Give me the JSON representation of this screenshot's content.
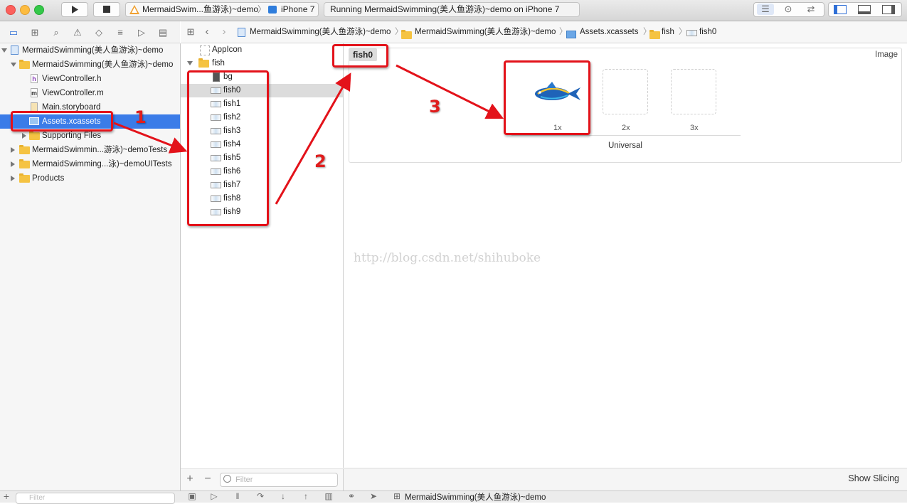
{
  "toolbar": {
    "scheme_target": "MermaidSwim...鱼游泳)~demo",
    "device": "iPhone 7",
    "activity": "Running MermaidSwimming(美人鱼游泳)~demo on iPhone 7"
  },
  "navigator": {
    "items": [
      {
        "label": "MermaidSwimming(美人鱼游泳)~demo"
      },
      {
        "label": "MermaidSwimming(美人鱼游泳)~demo"
      },
      {
        "label": "ViewController.h"
      },
      {
        "label": "ViewController.m"
      },
      {
        "label": "Main.storyboard"
      },
      {
        "label": "Assets.xcassets"
      },
      {
        "label": "Supporting Files"
      },
      {
        "label": "MermaidSwimmin...游泳)~demoTests"
      },
      {
        "label": "MermaidSwimming...泳)~demoUITests"
      },
      {
        "label": "Products"
      }
    ],
    "filter_placeholder": "Filter"
  },
  "jumpbar": {
    "crumbs": [
      "MermaidSwimming(美人鱼游泳)~demo",
      "MermaidSwimming(美人鱼游泳)~demo",
      "Assets.xcassets",
      "fish",
      "fish0"
    ]
  },
  "assets": {
    "appicon": "AppIcon",
    "folder": "fish",
    "items": [
      "bg",
      "fish0",
      "fish1",
      "fish2",
      "fish3",
      "fish4",
      "fish5",
      "fish6",
      "fish7",
      "fish8",
      "fish9"
    ],
    "selected": "fish0",
    "filter_placeholder": "Filter"
  },
  "editor": {
    "set_name": "fish0",
    "type_label": "Image",
    "scales": [
      "1x",
      "2x",
      "3x"
    ],
    "group_label": "Universal",
    "show_slicing": "Show Slicing"
  },
  "debug": {
    "target": "MermaidSwimming(美人鱼游泳)~demo"
  },
  "annotations": {
    "step1": "1",
    "step2": "2",
    "step3": "3",
    "watermark": "http://blog.csdn.net/shihuboke"
  },
  "colors": {
    "selection": "#3b7ce8",
    "annotation_red": "#e3121a",
    "folder_yellow": "#f5c342"
  }
}
